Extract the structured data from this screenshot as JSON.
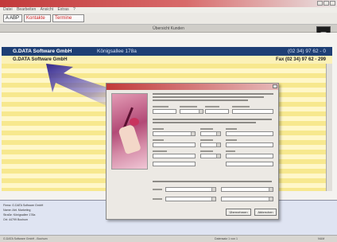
{
  "app": {
    "menu": [
      "Datei",
      "Bearbeiten",
      "Ansicht",
      "Extras",
      "?"
    ],
    "toolbar": [
      "A ABP",
      "Kontakte",
      "Termine"
    ],
    "bar_title": "Übersicht Kunden"
  },
  "record": {
    "header": {
      "company": "G.DATA Software GmbH",
      "street": "Königsallee 178a",
      "phone": "(02 34) 97 62 - 0"
    },
    "row2": {
      "company": "G.DATA Software GmbH",
      "fax": "Fax (02 34) 97 62 - 299"
    }
  },
  "dialog": {
    "buttons": [
      "Übernehmen",
      "Abbrechen"
    ]
  },
  "details": [
    "Firma:   G.DATA Software GmbH",
    "Name:    Abt. Marketing",
    "Straße:  Königsallee 178a",
    "Ort:     44799 Bochum"
  ],
  "statusbar": {
    "left": "G.DATA Software GmbH - Bochum",
    "middle": "Datensatz 1 von 1",
    "right": "NUM"
  },
  "colors": {
    "accent_red": "#c23a3a",
    "header_blue": "#1e3f75",
    "stripe_yellow": "#f7e88e",
    "arrow_purple": "#3a2b9c"
  }
}
